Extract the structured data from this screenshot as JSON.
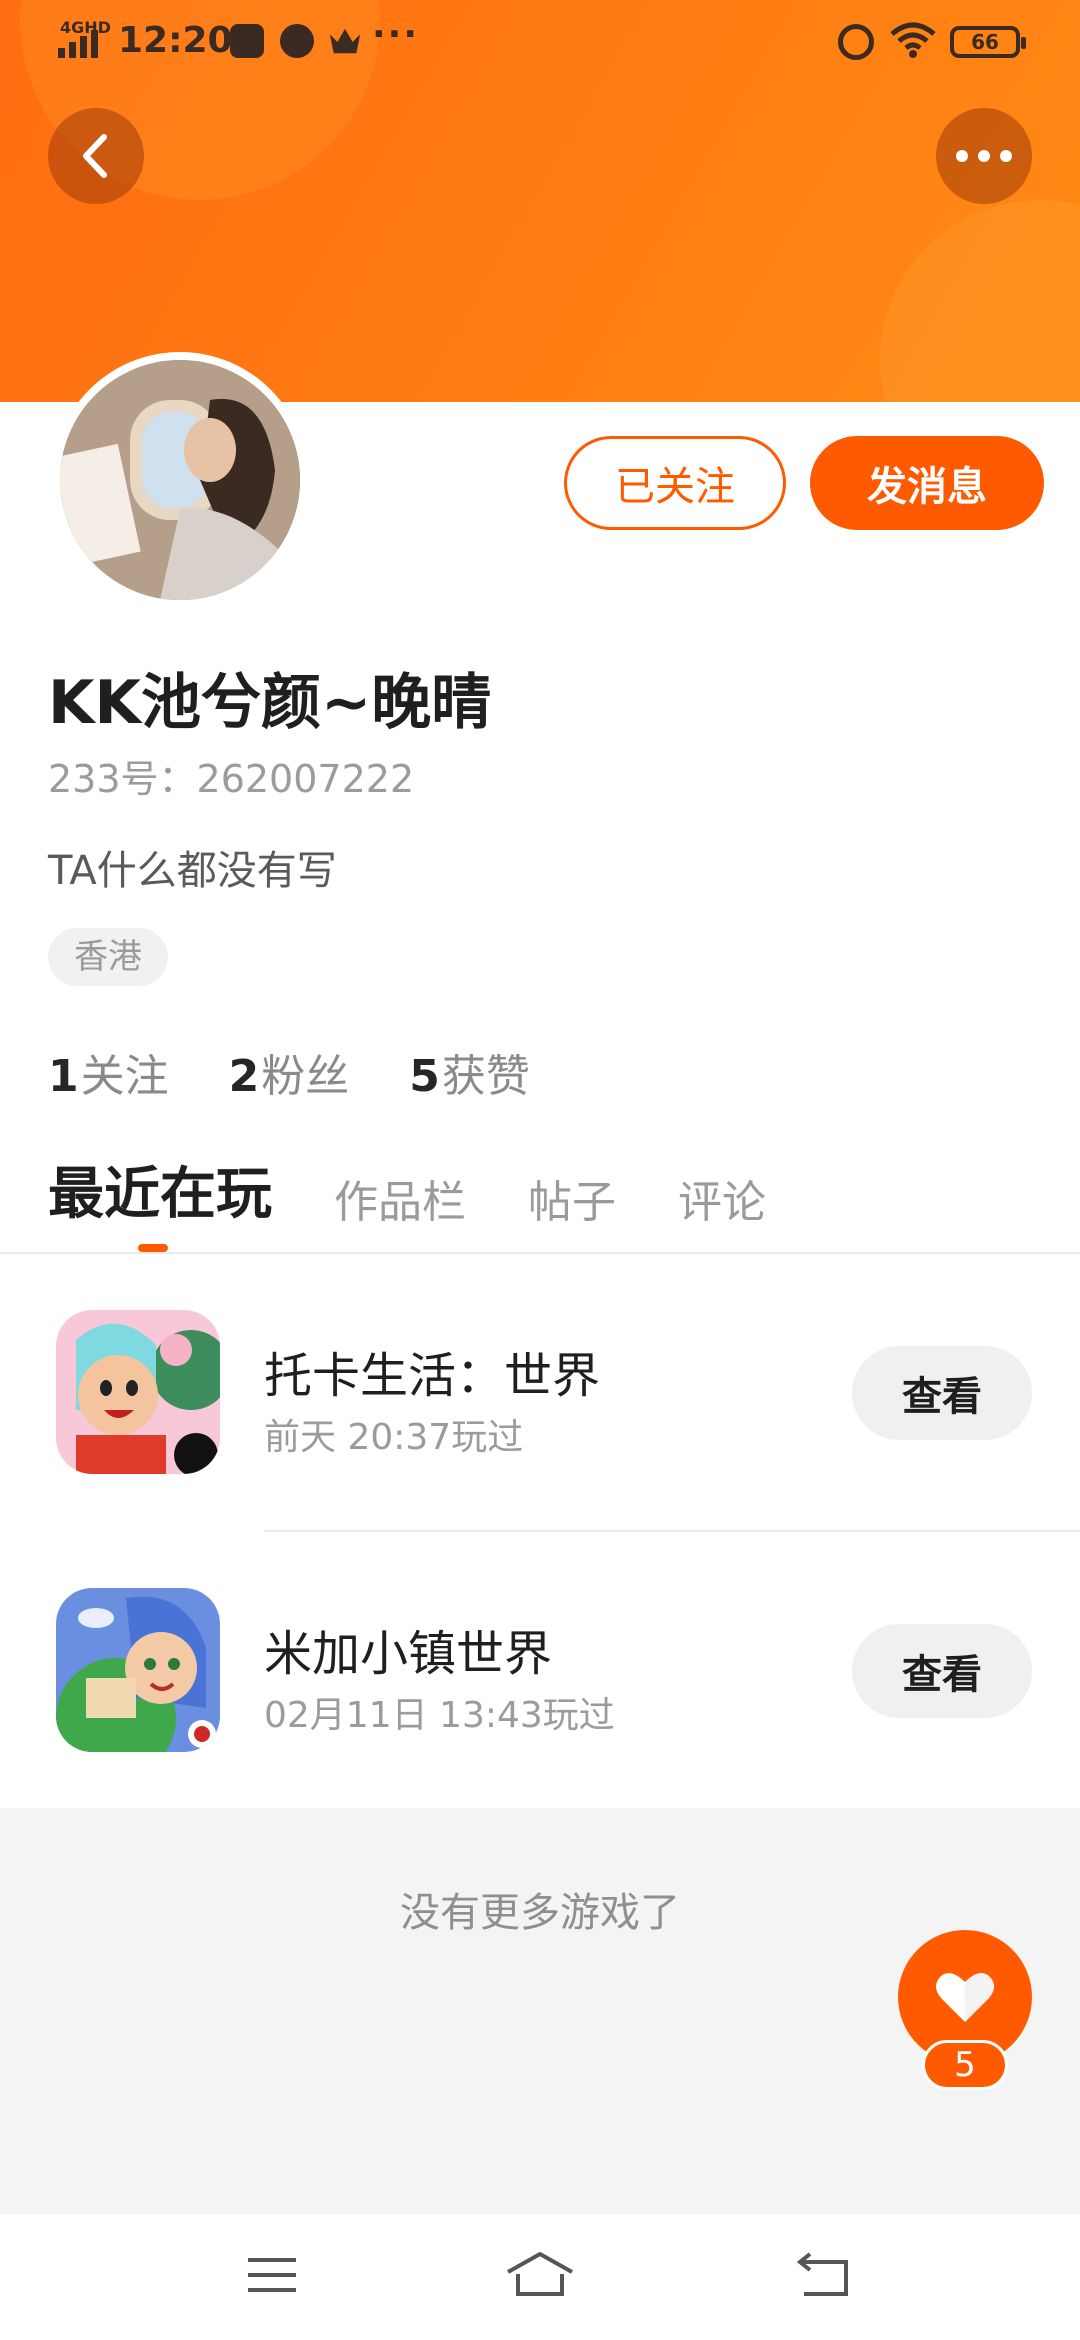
{
  "status_bar": {
    "network": "4GHD",
    "time": "12:20",
    "battery": "66",
    "more": "···"
  },
  "header": {
    "back_icon": "chevron-left-icon",
    "more_icon": "more-horizontal-icon"
  },
  "profile": {
    "followed_label": "已关注",
    "message_label": "发消息",
    "username": "KK池兮颜~晚晴",
    "uid": "233号：262007222",
    "bio": "TA什么都没有写",
    "region": "香港",
    "stats": [
      {
        "num": "1",
        "label": "关注"
      },
      {
        "num": "2",
        "label": "粉丝"
      },
      {
        "num": "5",
        "label": "获赞"
      }
    ]
  },
  "tabs": [
    "最近在玩",
    "作品栏",
    "帖子",
    "评论"
  ],
  "games": [
    {
      "title": "托卡生活：世界",
      "time": "前天 20:37玩过",
      "button": "查看"
    },
    {
      "title": "米加小镇世界",
      "time": "02月11日 13:43玩过",
      "button": "查看"
    }
  ],
  "footer": {
    "no_more": "没有更多游戏了"
  },
  "like": {
    "count": "5"
  },
  "colors": {
    "accent": "#ff5a00",
    "banner": "#ff7a12"
  }
}
